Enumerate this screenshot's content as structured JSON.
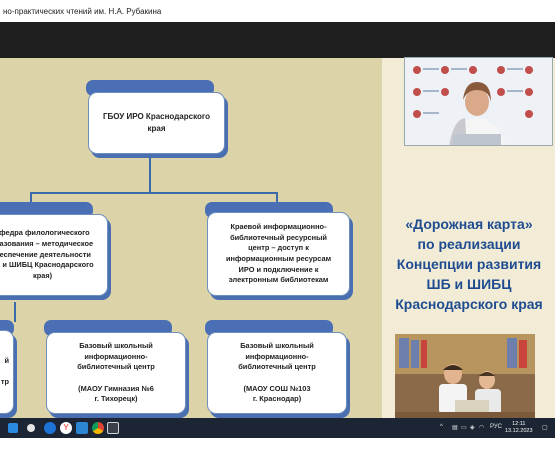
{
  "window": {
    "title": "но-практических чтений им. Н.А. Рубакина"
  },
  "slide": {
    "root": {
      "lines": [
        "ГБОУ ИРО Краснодарского",
        "края"
      ]
    },
    "left_box": {
      "lines": [
        "афедра филологического",
        "разования – методическое",
        "беспечение деятельности",
        "Б и ШИБЦ Краснодарского",
        "края)"
      ]
    },
    "right_box": {
      "lines": [
        "Краевой информационно-",
        "библиотечный ресурсный",
        "центр – доступ к",
        "информационным ресурсам",
        "ИРО и подключение к",
        "электронным библиотекам"
      ]
    },
    "edge_box": {
      "lines": [
        "й",
        "",
        "тр"
      ]
    },
    "school1": {
      "lines": [
        "Базовый школьный",
        "информационно-",
        "библиотечный центр",
        "",
        "(МАОУ Гимназия №6",
        "г. Тихорецк)"
      ]
    },
    "school2": {
      "lines": [
        "Базовый школьный",
        "информационно-",
        "библиотечный центр",
        "",
        "(МАОУ СОШ №103",
        "г. Краснодар)"
      ]
    },
    "heading": {
      "lines": [
        "«Дорожная карта»",
        "по реализации",
        "Концепции развития",
        "ШБ и ШИБЦ",
        "Краснодарского края"
      ]
    }
  },
  "taskbar": {
    "icons": [
      "windows-icon",
      "search-icon",
      "mail-icon",
      "yandex-icon",
      "store-icon",
      "chrome-icon",
      "media-icon"
    ],
    "tray_text": "РУС",
    "time": "12:11",
    "date": "13.12.2023"
  },
  "colors": {
    "heading": "#1f4c91",
    "box_border": "#4a6fb0",
    "panel": "#dcd3a9",
    "slide_bg": "#f2ecd6"
  }
}
